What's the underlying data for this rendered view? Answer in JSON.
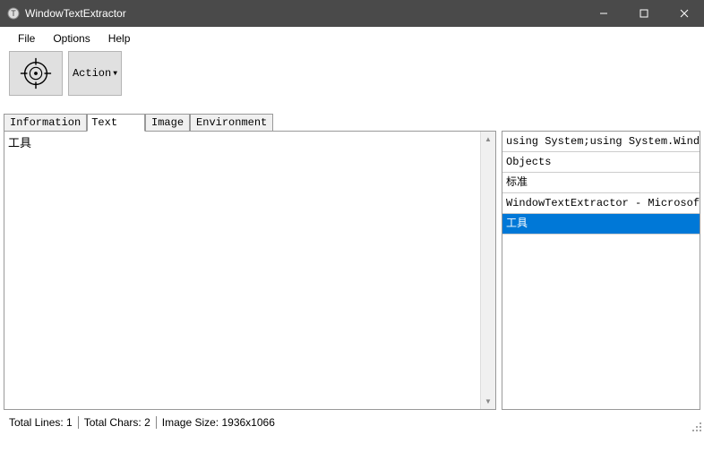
{
  "window": {
    "title": "WindowTextExtractor"
  },
  "menu": {
    "file": "File",
    "options": "Options",
    "help": "Help"
  },
  "toolbar": {
    "action_label": "Action"
  },
  "tabs": {
    "items": [
      {
        "label": "Information"
      },
      {
        "label": "Text"
      },
      {
        "label": "Image"
      },
      {
        "label": "Environment"
      }
    ],
    "active_index": 1
  },
  "text_content": "工具",
  "list": {
    "items": [
      {
        "text": "using System;using System.Window..."
      },
      {
        "text": "Objects"
      },
      {
        "text": "标准"
      },
      {
        "text": "WindowTextExtractor - Microsoft ..."
      },
      {
        "text": "工具"
      }
    ],
    "selected_index": 4
  },
  "statusbar": {
    "total_lines_label": "Total Lines: ",
    "total_lines_value": "1",
    "total_chars_label": "Total Chars: ",
    "total_chars_value": "2",
    "image_size_label": "Image Size: ",
    "image_size_value": "1936x1066"
  }
}
